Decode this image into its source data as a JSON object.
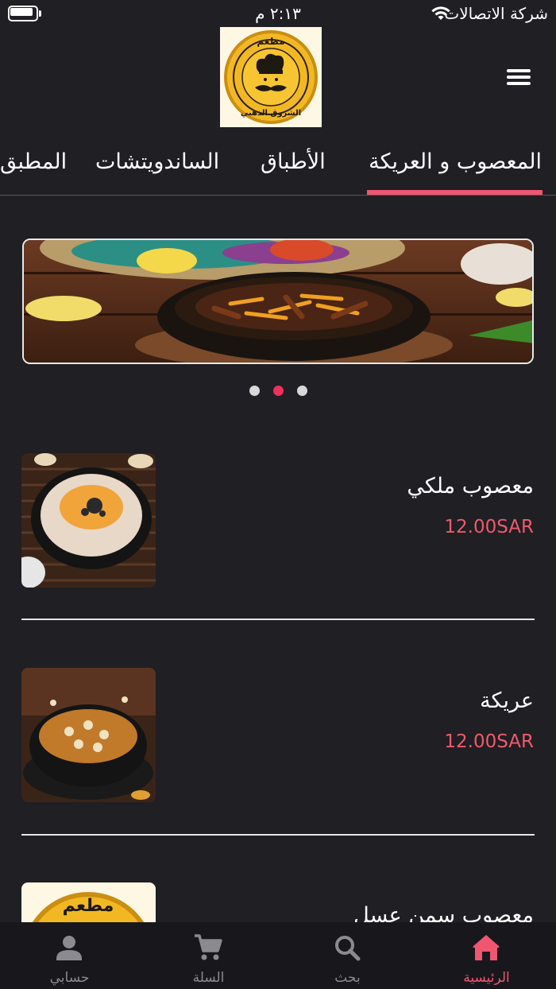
{
  "status_bar": {
    "time": "٢:١٣ م",
    "carrier": "شركة الاتصالات"
  },
  "header": {
    "logo_text_top": "مطعم",
    "logo_text_bottom": "الشروق الذهبي"
  },
  "tabs": [
    {
      "label": "المعصوب و العريكة",
      "active": true
    },
    {
      "label": "الأطباق",
      "active": false
    },
    {
      "label": "الساندويتشات",
      "active": false
    },
    {
      "label": "المطبق",
      "active": false
    }
  ],
  "carousel": {
    "slide_count": 3,
    "active_index": 1
  },
  "products": [
    {
      "name": "معصوب ملكي",
      "price": "12.00SAR"
    },
    {
      "name": "عريكة",
      "price": "12.00SAR"
    },
    {
      "name": "معصوب سمن عسل",
      "price": ""
    }
  ],
  "bottom_nav": [
    {
      "label": "الرئيسية",
      "icon": "home-icon",
      "active": true
    },
    {
      "label": "بحث",
      "icon": "search-icon",
      "active": false
    },
    {
      "label": "السلة",
      "icon": "cart-icon",
      "active": false
    },
    {
      "label": "حسابي",
      "icon": "person-icon",
      "active": false
    }
  ],
  "colors": {
    "background": "#1f1f24",
    "accent": "#f0566f",
    "price": "#ef5a6b",
    "logo_gold": "#f2b824"
  }
}
